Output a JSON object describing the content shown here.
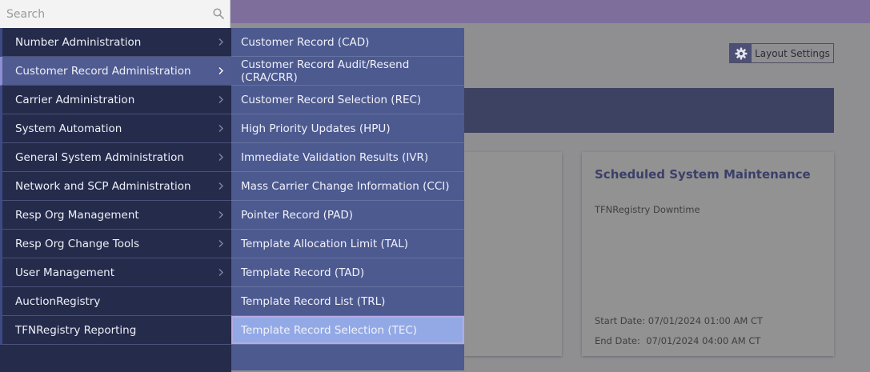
{
  "search": {
    "placeholder": "Search"
  },
  "toolbar": {
    "layout_settings_label": "Layout Settings"
  },
  "menu": {
    "level1": [
      {
        "label": "Number Administration",
        "has_submenu": true,
        "active": false
      },
      {
        "label": "Customer Record Administration",
        "has_submenu": true,
        "active": true
      },
      {
        "label": "Carrier Administration",
        "has_submenu": true,
        "active": false
      },
      {
        "label": "System Automation",
        "has_submenu": true,
        "active": false
      },
      {
        "label": "General System Administration",
        "has_submenu": true,
        "active": false
      },
      {
        "label": "Network and SCP Administration",
        "has_submenu": true,
        "active": false
      },
      {
        "label": "Resp Org Management",
        "has_submenu": true,
        "active": false
      },
      {
        "label": "Resp Org Change Tools",
        "has_submenu": true,
        "active": false
      },
      {
        "label": "User Management",
        "has_submenu": true,
        "active": false
      },
      {
        "label": "AuctionRegistry",
        "has_submenu": false,
        "active": false
      },
      {
        "label": "TFNRegistry Reporting",
        "has_submenu": false,
        "active": false
      }
    ],
    "level2": [
      {
        "label": "Customer Record (CAD)",
        "highlighted": false
      },
      {
        "label": "Customer Record Audit/Resend (CRA/CRR)",
        "highlighted": false
      },
      {
        "label": "Customer Record Selection (REC)",
        "highlighted": false
      },
      {
        "label": "High Priority Updates (HPU)",
        "highlighted": false
      },
      {
        "label": "Immediate Validation Results (IVR)",
        "highlighted": false
      },
      {
        "label": "Mass Carrier Change Information (CCI)",
        "highlighted": false
      },
      {
        "label": "Pointer Record (PAD)",
        "highlighted": false
      },
      {
        "label": "Template Allocation Limit (TAL)",
        "highlighted": false
      },
      {
        "label": "Template Record (TAD)",
        "highlighted": false
      },
      {
        "label": "Template Record List (TRL)",
        "highlighted": false
      },
      {
        "label": "Template Record Selection (TEC)",
        "highlighted": true
      }
    ]
  },
  "maintenance": {
    "title": "Scheduled System Maintenance",
    "subtitle": "TFNRegistry Downtime",
    "start_label": "Start Date:",
    "start_value": "07/01/2024 01:00 AM CT",
    "end_label": "End Date:",
    "end_value": "07/01/2024 04:00 AM CT"
  },
  "colors": {
    "topbar": "#7e6e9b",
    "menu_level1_bg": "#252b4b",
    "menu_level2_bg": "#4d5a90",
    "highlight": "#93a9e6",
    "card_title": "#3b3f69"
  }
}
